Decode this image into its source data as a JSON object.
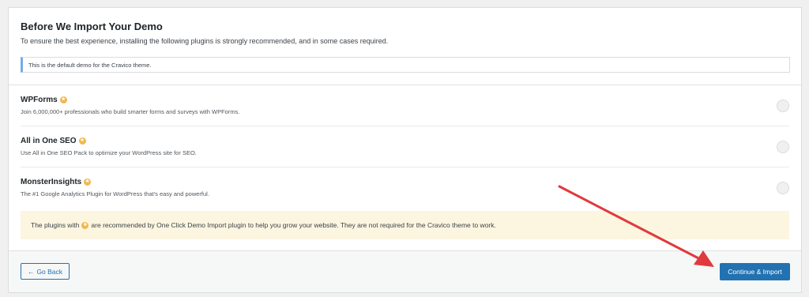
{
  "header": {
    "title": "Before We Import Your Demo",
    "subtitle": "To ensure the best experience, installing the following plugins is strongly recommended, and in some cases required."
  },
  "notice": {
    "text": "This is the default demo for the Cravico theme."
  },
  "plugins": [
    {
      "name": "WPForms",
      "description": "Join 6,000,000+ professionals who build smarter forms and surveys with WPForms."
    },
    {
      "name": "All in One SEO",
      "description": "Use All in One SEO Pack to optimize your WordPress site for SEO."
    },
    {
      "name": "MonsterInsights",
      "description": "The #1 Google Analytics Plugin for WordPress that's easy and powerful."
    }
  ],
  "tip": {
    "before": "The plugins with",
    "after": "are recommended by One Click Demo Import plugin to help you grow your website. They are not required for the Cravico theme to work."
  },
  "footer": {
    "back_arrow": "←",
    "back_label": "Go Back",
    "continue_label": "Continue & Import"
  },
  "icons": {
    "recommended": "star-icon"
  },
  "colors": {
    "accent": "#2271b1",
    "star": "#f0b849",
    "tip_bg": "#fcf5e0",
    "annotation_arrow": "#e03a3e"
  }
}
